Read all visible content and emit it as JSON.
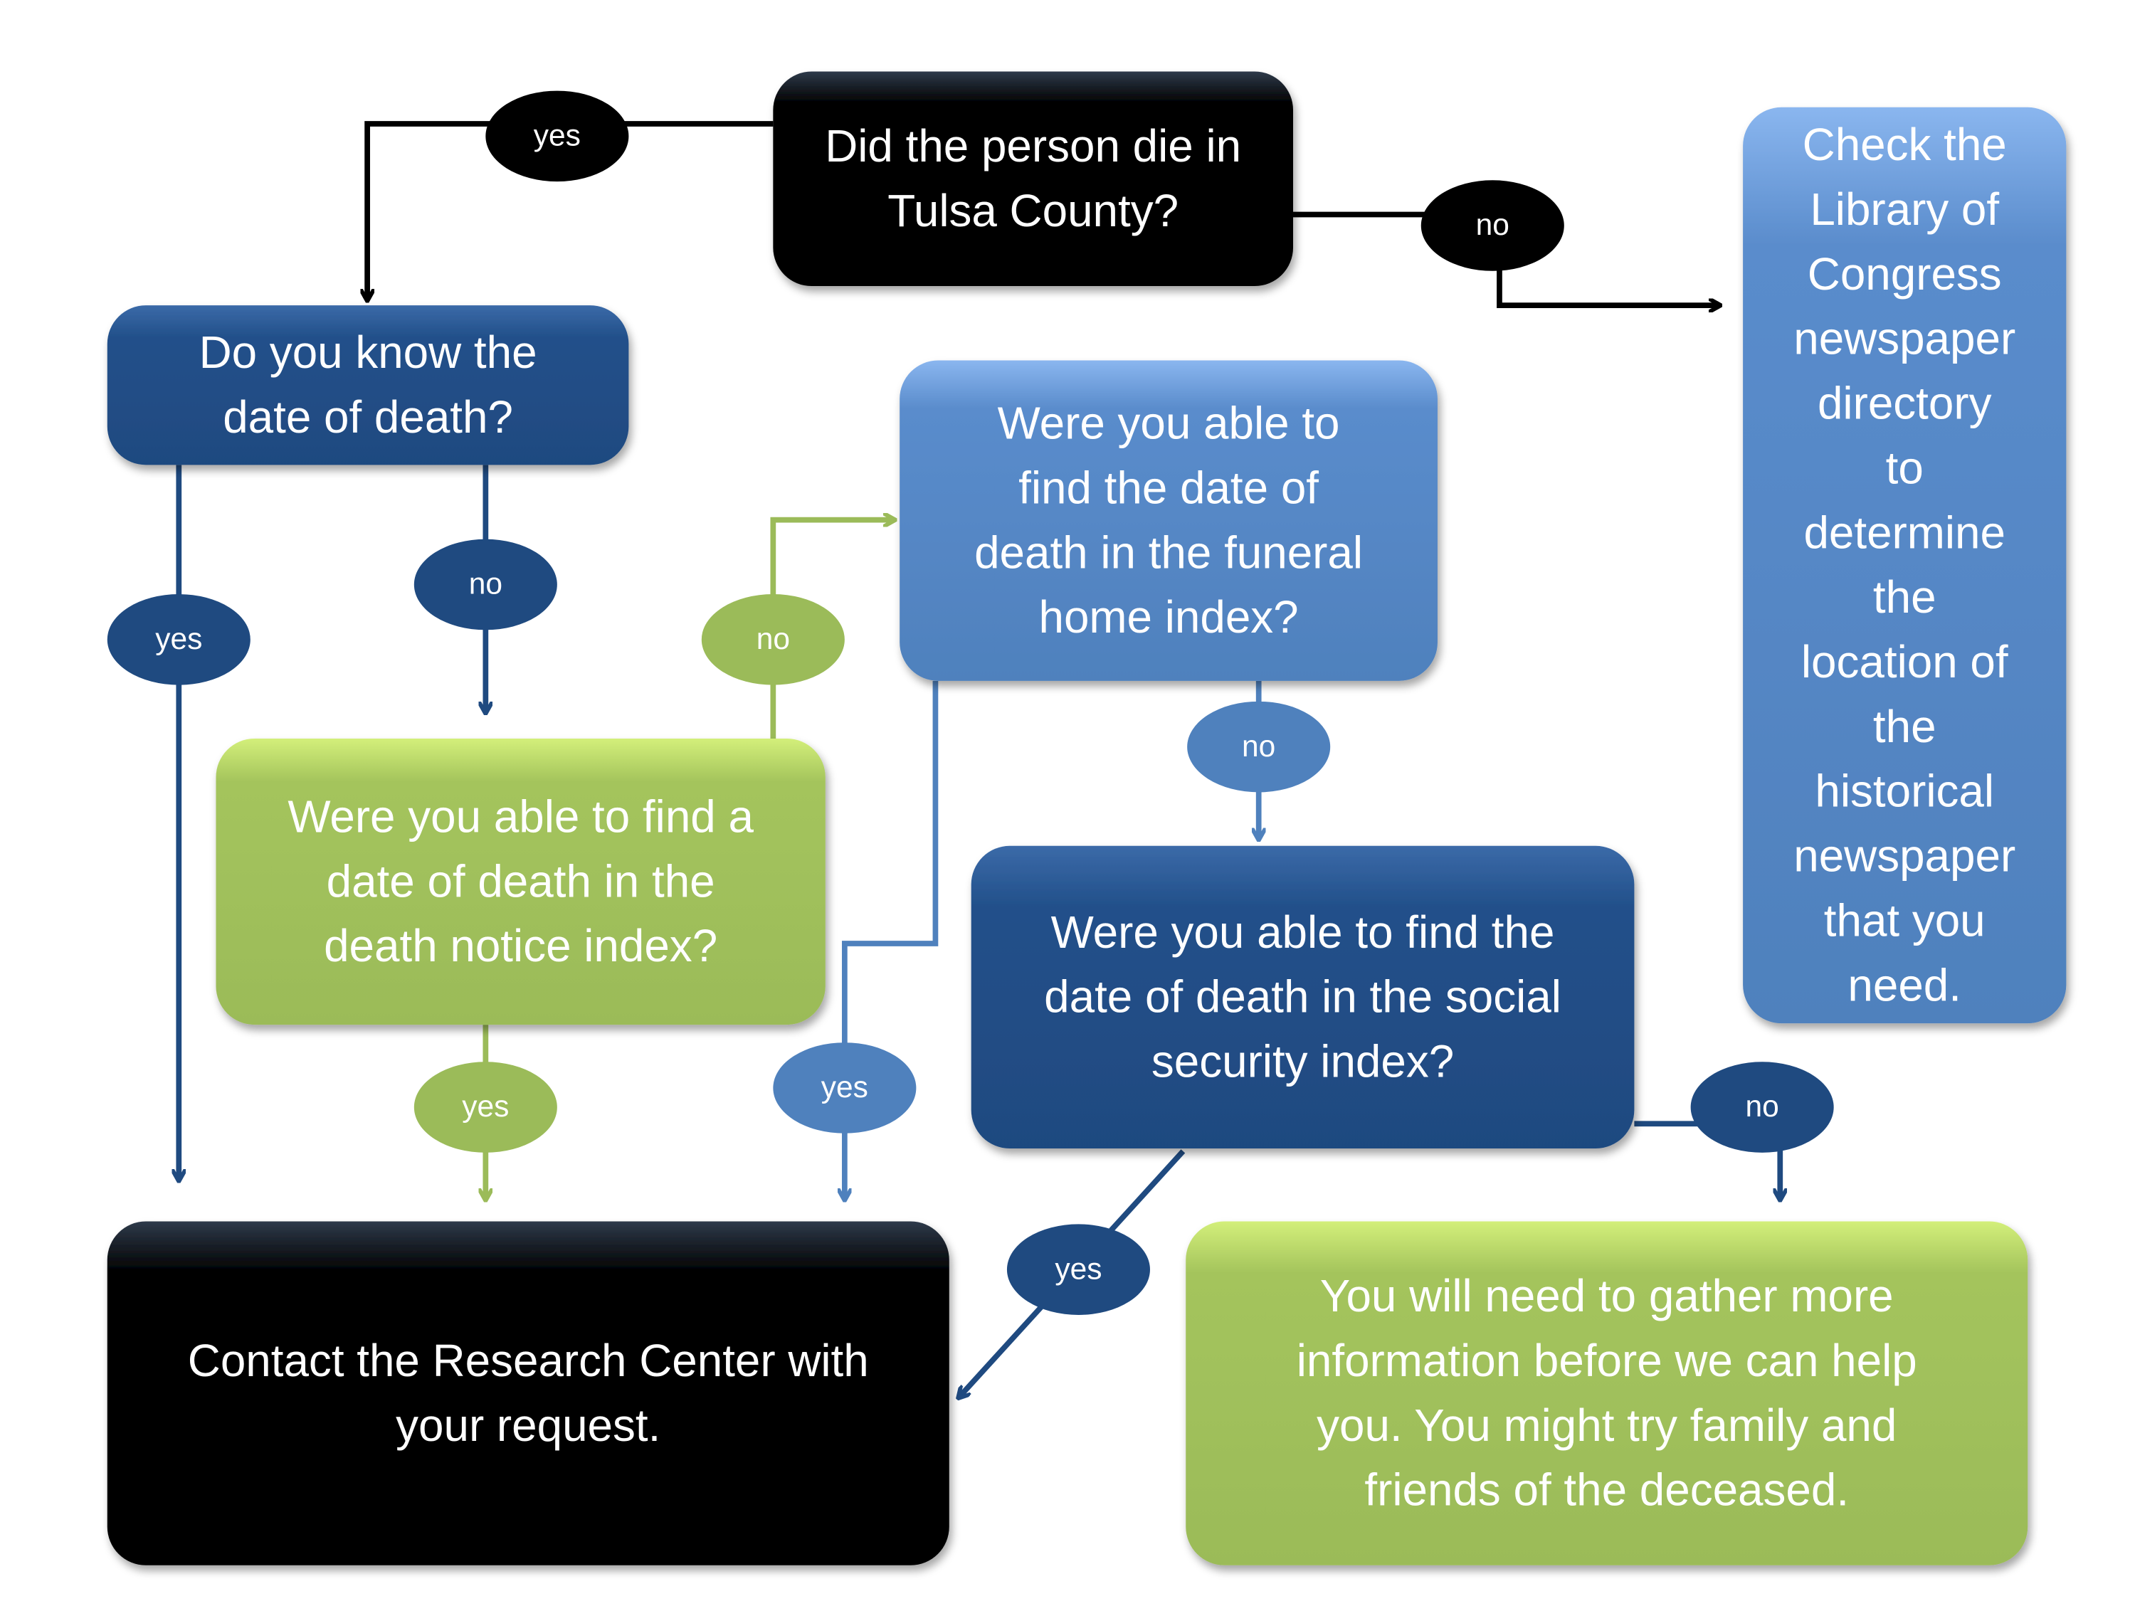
{
  "colors": {
    "black": "#000000",
    "dark_blue": "#1f4a80",
    "mid_blue": "#4f81bd",
    "green": "#9bbb59",
    "text": "#ffffff"
  },
  "nodes": {
    "tulsa": {
      "lines": [
        "Did the person die in",
        "Tulsa County?"
      ]
    },
    "know_date": {
      "lines": [
        "Do you know the",
        "date of death?"
      ]
    },
    "funeral": {
      "lines": [
        "Were you able to",
        "find the date of",
        "death in the funeral",
        "home index?"
      ]
    },
    "notice": {
      "lines": [
        "Were you able to find a",
        "date of death in the",
        "death notice index?"
      ]
    },
    "social": {
      "lines": [
        "Were you able to find the",
        "date of death in the social",
        "security index?"
      ]
    },
    "library": {
      "lines": [
        "Check the",
        "Library of",
        "Congress",
        "newspaper",
        "directory",
        "to",
        "determine",
        "the",
        "location of",
        "the",
        "historical",
        "newspaper",
        "that you",
        "need."
      ]
    },
    "contact": {
      "lines": [
        "Contact the Research Center with",
        "your request."
      ]
    },
    "gather": {
      "lines": [
        "You will need to gather more",
        "information before we can help",
        "you. You might try family and",
        "friends of the deceased."
      ]
    }
  },
  "edges": {
    "tulsa_yes": "yes",
    "tulsa_no": "no",
    "know_yes": "yes",
    "know_no": "no",
    "notice_no": "no",
    "notice_yes": "yes",
    "funeral_no": "no",
    "funeral_yes": "yes",
    "social_yes": "yes",
    "social_no": "no"
  }
}
